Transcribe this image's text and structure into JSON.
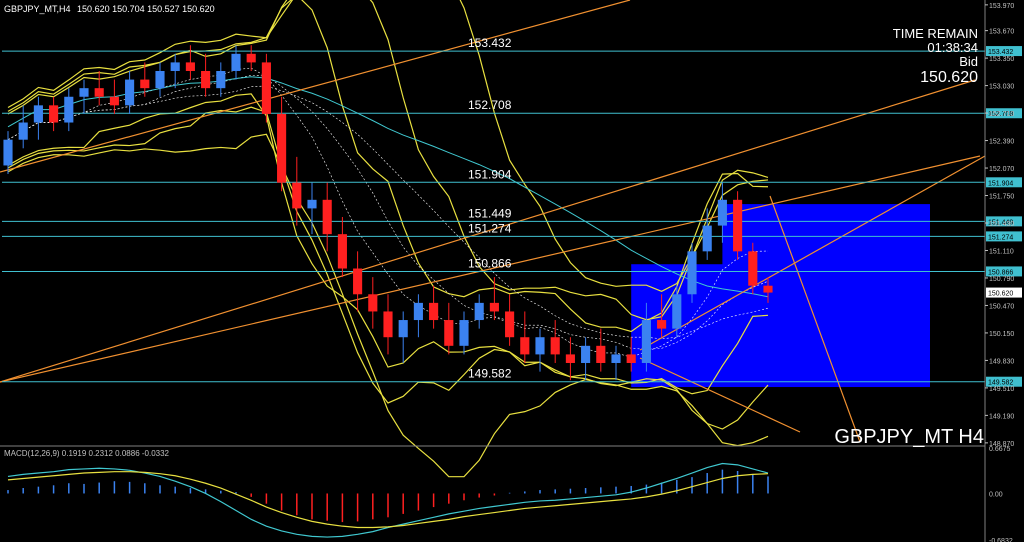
{
  "header": {
    "symbol_info": "GBPJPY_MT,H4",
    "ohlc": "150.620 150.704 150.527 150.620"
  },
  "info": {
    "time_remain_label": "TIME REMAIN",
    "time_remain": "01:38:34",
    "bid_label": "Bid",
    "bid": "150.620"
  },
  "watermark": "GBPJPY_MT H4",
  "macd": {
    "label": "MACD(12,26,9) 0.1919 0.2312 0.0886 -0.0332",
    "scale": [
      "0.6675",
      "0.00",
      "-0.6832"
    ]
  },
  "colors": {
    "bull": "#3b82f0",
    "bear": "#ff2020",
    "bollinger": "#e8e040",
    "ma_cyan": "#40c8d0",
    "level_line": "#40c0d0",
    "trend_orange": "#f09030",
    "zone_blue": "#0000ff",
    "macd_signal": "#e8e040",
    "macd_line": "#40c8d0"
  },
  "chart_data": {
    "type": "candlestick",
    "price_axis": {
      "range": [
        148.88,
        153.98
      ],
      "ticks": [
        "153.970",
        "153.670",
        "153.350",
        "153.030",
        "152.710",
        "152.390",
        "152.070",
        "151.750",
        "151.430",
        "151.110",
        "150.790",
        "150.470",
        "150.150",
        "149.830",
        "149.510",
        "149.190",
        "148.870"
      ]
    },
    "levels": [
      {
        "price": 153.432,
        "label": "153.432",
        "tag": "153.432"
      },
      {
        "price": 152.708,
        "label": "152.708",
        "tag": "152.708"
      },
      {
        "price": 151.904,
        "label": "151.904",
        "tag": "151.904"
      },
      {
        "price": 151.449,
        "label": "151.449",
        "tag": "151.449"
      },
      {
        "price": 151.274,
        "label": "151.274",
        "tag": "151.274"
      },
      {
        "price": 150.866,
        "label": "150.866",
        "tag": "150.866"
      },
      {
        "price": 149.582,
        "label": "149.582",
        "tag": "149.582"
      }
    ],
    "current_price": {
      "price": 150.62,
      "tag": "150.620"
    },
    "candles": [
      [
        152.1,
        152.5,
        152.0,
        152.4
      ],
      [
        152.4,
        152.8,
        152.3,
        152.6
      ],
      [
        152.6,
        152.9,
        152.4,
        152.8
      ],
      [
        152.8,
        152.9,
        152.5,
        152.6
      ],
      [
        152.6,
        153.0,
        152.5,
        152.9
      ],
      [
        152.9,
        153.1,
        152.7,
        153.0
      ],
      [
        153.0,
        153.2,
        152.8,
        152.9
      ],
      [
        152.9,
        153.1,
        152.7,
        152.8
      ],
      [
        152.8,
        153.2,
        152.7,
        153.1
      ],
      [
        153.1,
        153.3,
        152.9,
        153.0
      ],
      [
        153.0,
        153.3,
        152.9,
        153.2
      ],
      [
        153.2,
        153.4,
        153.0,
        153.3
      ],
      [
        153.3,
        153.5,
        153.1,
        153.2
      ],
      [
        153.2,
        153.4,
        152.9,
        153.0
      ],
      [
        153.0,
        153.3,
        152.9,
        153.2
      ],
      [
        153.2,
        153.5,
        153.1,
        153.4
      ],
      [
        153.4,
        153.5,
        153.2,
        153.3
      ],
      [
        153.3,
        153.4,
        152.6,
        152.7
      ],
      [
        152.7,
        152.9,
        151.8,
        151.9
      ],
      [
        151.9,
        152.2,
        151.4,
        151.6
      ],
      [
        151.6,
        151.9,
        151.3,
        151.7
      ],
      [
        151.7,
        151.9,
        151.1,
        151.3
      ],
      [
        151.3,
        151.5,
        150.8,
        150.9
      ],
      [
        150.9,
        151.1,
        150.4,
        150.6
      ],
      [
        150.6,
        150.8,
        150.2,
        150.4
      ],
      [
        150.4,
        150.6,
        149.9,
        150.1
      ],
      [
        150.1,
        150.4,
        149.8,
        150.3
      ],
      [
        150.3,
        150.6,
        150.1,
        150.5
      ],
      [
        150.5,
        150.7,
        150.2,
        150.3
      ],
      [
        150.3,
        150.5,
        149.9,
        150.0
      ],
      [
        150.0,
        150.4,
        149.9,
        150.3
      ],
      [
        150.3,
        150.6,
        150.2,
        150.5
      ],
      [
        150.5,
        150.8,
        150.3,
        150.4
      ],
      [
        150.4,
        150.6,
        150.0,
        150.1
      ],
      [
        150.1,
        150.4,
        149.8,
        149.9
      ],
      [
        149.9,
        150.2,
        149.7,
        150.1
      ],
      [
        150.1,
        150.3,
        149.8,
        149.9
      ],
      [
        149.9,
        150.1,
        149.6,
        149.8
      ],
      [
        149.8,
        150.1,
        149.6,
        150.0
      ],
      [
        150.0,
        150.2,
        149.7,
        149.8
      ],
      [
        149.8,
        150.0,
        149.6,
        149.9
      ],
      [
        149.9,
        150.1,
        149.7,
        149.8
      ],
      [
        149.8,
        150.5,
        149.7,
        150.3
      ],
      [
        150.3,
        150.6,
        150.1,
        150.2
      ],
      [
        150.2,
        150.7,
        150.1,
        150.6
      ],
      [
        150.6,
        151.2,
        150.5,
        151.1
      ],
      [
        151.1,
        151.6,
        151.0,
        151.4
      ],
      [
        151.4,
        151.9,
        151.2,
        151.7
      ],
      [
        151.7,
        151.8,
        151.0,
        151.1
      ],
      [
        151.1,
        151.2,
        150.6,
        150.7
      ],
      [
        150.7,
        150.8,
        150.5,
        150.62
      ]
    ],
    "macd_histogram": [
      0.05,
      0.08,
      0.1,
      0.12,
      0.15,
      0.14,
      0.16,
      0.18,
      0.17,
      0.15,
      0.12,
      0.1,
      0.08,
      0.06,
      0.04,
      0.02,
      -0.05,
      -0.15,
      -0.25,
      -0.32,
      -0.38,
      -0.4,
      -0.42,
      -0.41,
      -0.38,
      -0.35,
      -0.3,
      -0.25,
      -0.2,
      -0.15,
      -0.1,
      -0.06,
      -0.03,
      0.01,
      0.03,
      0.05,
      0.06,
      0.07,
      0.08,
      0.09,
      0.1,
      0.11,
      0.13,
      0.16,
      0.2,
      0.24,
      0.3,
      0.35,
      0.33,
      0.28,
      0.25
    ],
    "macd_line": [
      0.25,
      0.28,
      0.3,
      0.32,
      0.35,
      0.36,
      0.37,
      0.36,
      0.34,
      0.3,
      0.25,
      0.18,
      0.1,
      0.0,
      -0.12,
      -0.25,
      -0.38,
      -0.48,
      -0.55,
      -0.6,
      -0.63,
      -0.64,
      -0.63,
      -0.6,
      -0.56,
      -0.5,
      -0.45,
      -0.4,
      -0.35,
      -0.3,
      -0.26,
      -0.22,
      -0.19,
      -0.16,
      -0.13,
      -0.11,
      -0.1,
      -0.08,
      -0.06,
      -0.04,
      -0.02,
      0.02,
      0.08,
      0.15,
      0.22,
      0.3,
      0.38,
      0.44,
      0.42,
      0.36,
      0.3
    ],
    "macd_signal": [
      0.2,
      0.22,
      0.24,
      0.26,
      0.28,
      0.3,
      0.31,
      0.32,
      0.32,
      0.31,
      0.29,
      0.26,
      0.21,
      0.15,
      0.08,
      -0.01,
      -0.1,
      -0.2,
      -0.28,
      -0.35,
      -0.41,
      -0.45,
      -0.48,
      -0.5,
      -0.5,
      -0.49,
      -0.47,
      -0.44,
      -0.41,
      -0.38,
      -0.34,
      -0.31,
      -0.28,
      -0.25,
      -0.22,
      -0.2,
      -0.18,
      -0.16,
      -0.14,
      -0.12,
      -0.1,
      -0.08,
      -0.05,
      -0.01,
      0.04,
      0.1,
      0.16,
      0.22,
      0.26,
      0.28,
      0.29
    ]
  }
}
